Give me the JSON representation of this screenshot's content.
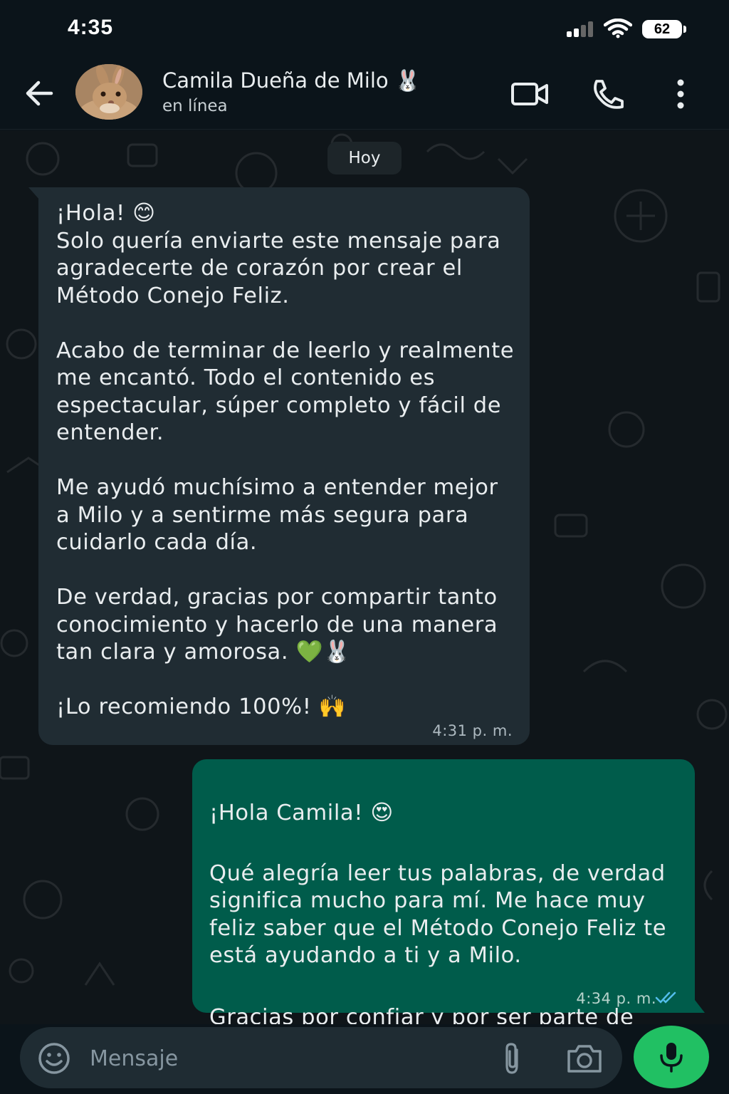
{
  "status_bar": {
    "time": "4:35",
    "battery": "62"
  },
  "header": {
    "contact_name": "Camila Dueña de Milo 🐰",
    "contact_status": "en línea"
  },
  "chat": {
    "date_chip": "Hoy",
    "incoming": {
      "text": "¡Hola! 😊\nSolo quería enviarte este mensaje para agradecerte de corazón por crear el Método Conejo Feliz.\n\nAcabo de terminar de leerlo y realmente me encantó. Todo el contenido es espectacular, súper completo y fácil de entender.\n\nMe ayudó muchísimo a entender mejor a Milo y a sentirme más segura para cuidarlo cada día.\n\nDe verdad, gracias por compartir tanto conocimiento y hacerlo de una manera tan clara y amorosa. 💚🐰\n\n¡Lo recomiendo 100%! 🙌",
      "time": "4:31 p. m."
    },
    "outgoing": {
      "line1": "¡Hola Camila! 😍",
      "para1": "Qué alegría leer tus palabras, de verdad significa mucho para mí. Me hace muy feliz saber que el Método Conejo Feliz te está ayudando a ti y a Milo.",
      "para2": "Gracias por confiar y por ser parte de esta comunidad. ¡Aquí estoy siempre para lo que necesites! 🐰💚",
      "time": "4:34 p. m."
    }
  },
  "composer": {
    "placeholder": "Mensaje"
  },
  "colors": {
    "background": "#0b141a",
    "incoming_bubble": "#202c33",
    "outgoing_bubble": "#005c4b",
    "accent_green": "#21c063",
    "read_ticks": "#53bdeb"
  },
  "icons": {
    "back": "arrow-left-icon",
    "video": "video-camera-icon",
    "call": "phone-icon",
    "menu": "more-vertical-icon",
    "emoji": "emoji-icon",
    "attach": "paperclip-icon",
    "camera": "camera-icon",
    "mic": "microphone-icon"
  }
}
